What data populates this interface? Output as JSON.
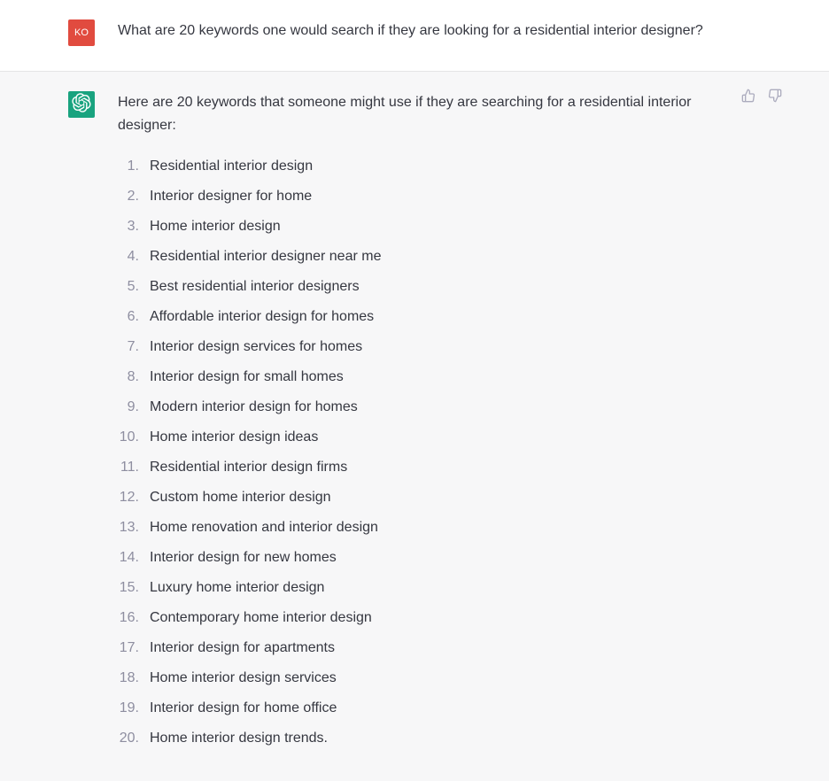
{
  "user": {
    "avatar_initials": "KO",
    "message": "What are 20 keywords one would search if they are looking for a residential interior designer?"
  },
  "assistant": {
    "intro": "Here are 20 keywords that someone might use if they are searching for a residential interior designer:",
    "items": [
      "Residential interior design",
      "Interior designer for home",
      "Home interior design",
      "Residential interior designer near me",
      "Best residential interior designers",
      "Affordable interior design for homes",
      "Interior design services for homes",
      "Interior design for small homes",
      "Modern interior design for homes",
      "Home interior design ideas",
      "Residential interior design firms",
      "Custom home interior design",
      "Home renovation and interior design",
      "Interior design for new homes",
      "Luxury home interior design",
      "Contemporary home interior design",
      "Interior design for apartments",
      "Home interior design services",
      "Interior design for home office",
      "Home interior design trends."
    ]
  }
}
